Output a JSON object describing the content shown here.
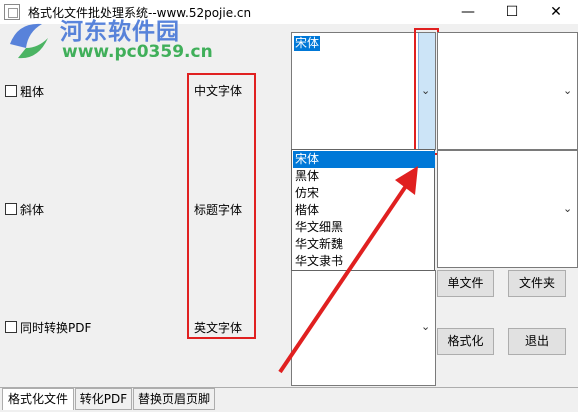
{
  "window": {
    "title": "格式化文件批处理系统--www.52pojie.cn"
  },
  "watermark": {
    "site_name": "河东软件园",
    "url": "www.pc0359.cn"
  },
  "options": {
    "bold_label": "粗体",
    "italic_label": "斜体",
    "convert_pdf_label": "同时转换PDF"
  },
  "font_labels": {
    "chinese": "中文字体",
    "title": "标题字体",
    "english": "英文字体"
  },
  "combos": {
    "chinese_value": "宋体"
  },
  "dropdown": {
    "items": [
      "宋体",
      "黑体",
      "仿宋",
      "楷体",
      "华文细黑",
      "华文新魏",
      "华文隶书"
    ],
    "selected_index": 0
  },
  "buttons": {
    "single_file": "单文件",
    "folder": "文件夹",
    "format": "格式化",
    "exit": "退出"
  },
  "tabs": [
    "格式化文件",
    "转化PDF",
    "替换页眉页脚"
  ],
  "active_tab": 0,
  "colors": {
    "highlight": "#e02020",
    "selection": "#0078d7"
  }
}
